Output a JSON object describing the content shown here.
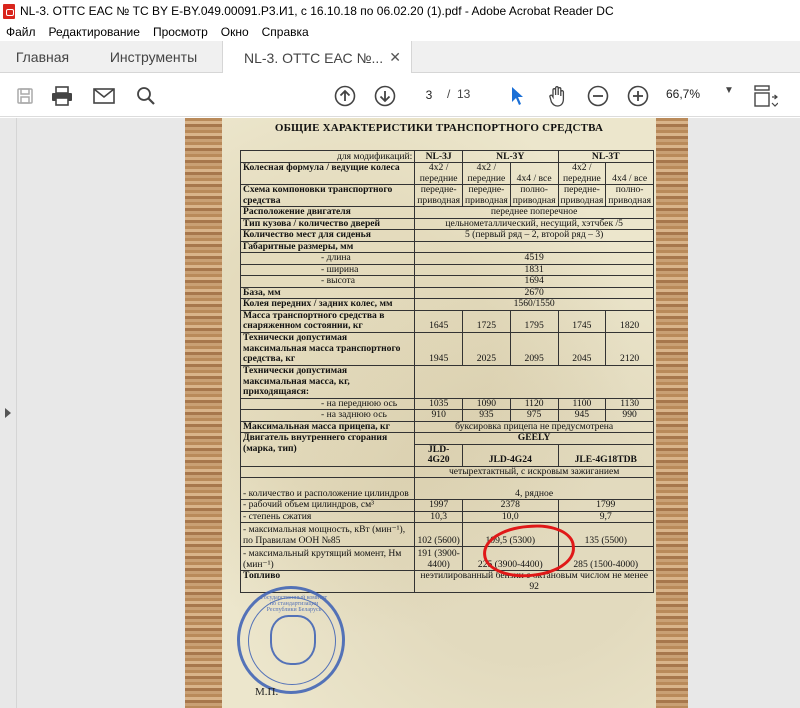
{
  "window": {
    "title": "NL-3. ОТТС ЕАС № ТС BY E-BY.049.00091.Р3.И1, с 16.10.18 по 06.02.20 (1).pdf - Adobe Acrobat Reader DC"
  },
  "menu": [
    "Файл",
    "Редактирование",
    "Просмотр",
    "Окно",
    "Справка"
  ],
  "tabs": {
    "home": "Главная",
    "tools": "Инструменты",
    "document": "NL-3. ОТТС ЕАС №..."
  },
  "toolbar": {
    "icons": [
      "save-icon",
      "print-icon",
      "email-icon",
      "search-icon",
      "page-up-icon",
      "page-down-icon",
      "select-cursor-icon",
      "hand-icon",
      "zoom-out-icon",
      "zoom-in-icon",
      "fit-page-icon"
    ],
    "current_page": "3",
    "separator": "/",
    "total_pages": "13",
    "zoom": "66,7%",
    "zoom_caret": "▼"
  },
  "document": {
    "heading": "ОБЩИЕ ХАРАКТЕРИСТИКИ ТРАНСПОРТНОГО СРЕДСТВА",
    "col_models": [
      "NL-3J",
      "NL-3Y",
      "NL-3T"
    ],
    "rows": {
      "modification": "для модификаций:",
      "wheel_formula": "Колесная формула / ведущие колеса",
      "wheel_cells": [
        "4x2 / передние",
        "4x2 / передние",
        "4x4 / все",
        "4x2 / передние",
        "4x4 / все"
      ],
      "layout": "Схема компоновки транспортного средства",
      "layout_cells": [
        "передне-приводная",
        "передне-приводная",
        "полно-приводная",
        "передне-приводная",
        "полно-приводная"
      ],
      "engine_pos": "Расположение двигателя",
      "engine_pos_val": "переднее поперечное",
      "body": "Тип кузова / количество дверей",
      "body_val": "цельнометаллический, несущий, хэтчбек /5",
      "seats": "Количество мест для сиденья",
      "seats_val": "5 (первый ряд – 2, второй ряд – 3)",
      "dims": "Габаритные размеры, мм",
      "length": "- длина",
      "length_val": "4519",
      "width": "- ширина",
      "width_val": "1831",
      "height": "- высота",
      "height_val": "1694",
      "base": "База, мм",
      "base_val": "2670",
      "track": "Колея передних / задних колес, мм",
      "track_val": "1560/1550",
      "curb": "Масса транспортного средства в снаряженном состоянии, кг",
      "curb_vals": [
        "1645",
        "1725",
        "1795",
        "1745",
        "1820"
      ],
      "gvw": "Технически допустимая максимальная масса транспортного средства, кг",
      "gvw_vals": [
        "1945",
        "2025",
        "2095",
        "2045",
        "2120"
      ],
      "axle": "Технически допустимая максимальная масса, кг, приходящаяся:",
      "front_axle": "- на переднюю ось",
      "front_vals": [
        "1035",
        "1090",
        "1120",
        "1100",
        "1130"
      ],
      "rear_axle": "- на заднюю ось",
      "rear_vals": [
        "910",
        "935",
        "975",
        "945",
        "990"
      ],
      "trailer": "Максимальная масса прицепа, кг",
      "trailer_val": "буксировка прицепа не предусмотрена",
      "engine": "Двигатель внутреннего сгорания (марка, тип)",
      "brand": "GEELY",
      "engine_models": [
        "JLD-4G20",
        "JLD-4G24",
        "JLE-4G18TDB"
      ],
      "engine_type": "четырехтактный, с искровым зажиганием",
      "cyl": "- количество и расположение цилиндров",
      "cyl_val": "4, рядное",
      "displacement": "- рабочий объем цилиндров, см³",
      "disp_vals": [
        "1997",
        "2378",
        "1799"
      ],
      "compression": "- степень сжатия",
      "comp_vals": [
        "10,3",
        "10,0",
        "9,7"
      ],
      "power": "- максимальная мощность, кВт (мин⁻¹), по Правилам ООН №85",
      "power_vals": [
        "102 (5600)",
        "109,5 (5300)",
        "135 (5500)"
      ],
      "torque": "- максимальный крутящий момент, Нм (мин⁻¹)",
      "torque_vals": [
        "191 (3900-4400)",
        "225 (3900-4400)",
        "285 (1500-4000)"
      ],
      "fuel": "Топливо",
      "fuel_val": "неэтилированный бензин с октановым числом не менее 92"
    },
    "stamp_text": "Государственный комитет по стандартизации Республики Беларусь",
    "mp": "М.П."
  }
}
